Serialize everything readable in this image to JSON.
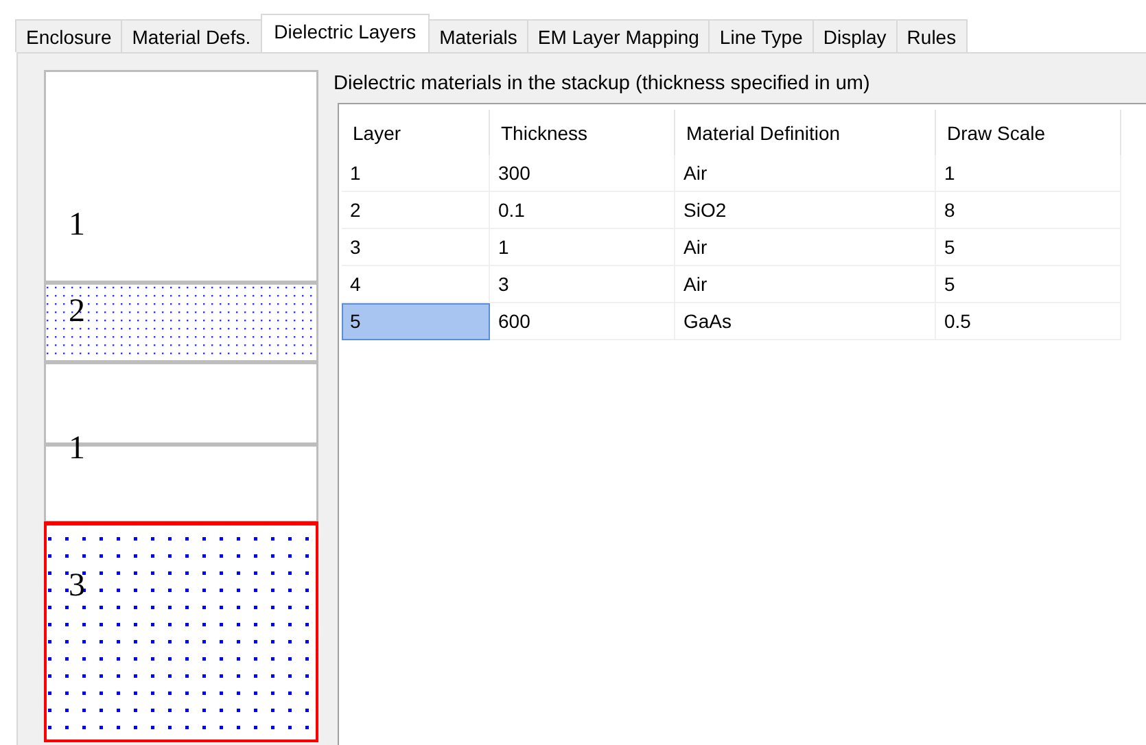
{
  "tabs": [
    {
      "label": "Enclosure",
      "selected": false
    },
    {
      "label": "Material Defs.",
      "selected": false
    },
    {
      "label": "Dielectric Layers",
      "selected": true
    },
    {
      "label": "Materials",
      "selected": false
    },
    {
      "label": "EM Layer Mapping",
      "selected": false
    },
    {
      "label": "Line Type",
      "selected": false
    },
    {
      "label": "Display",
      "selected": false
    },
    {
      "label": "Rules",
      "selected": false
    }
  ],
  "stackup_drawing": {
    "layers": [
      {
        "label": "1",
        "kind": "plain",
        "selected": false
      },
      {
        "label": "2",
        "kind": "fine-dots",
        "selected": false
      },
      {
        "kind": "plain",
        "selected": false
      },
      {
        "label": "1",
        "kind": "plain",
        "selected": false
      },
      {
        "label": "3",
        "kind": "coarse-dots",
        "selected": true
      }
    ]
  },
  "table": {
    "caption": "Dielectric materials in the stackup (thickness specified in um)",
    "columns": [
      "Layer",
      "Thickness",
      "Material Definition",
      "Draw Scale"
    ],
    "rows": [
      {
        "cells": [
          "1",
          "300",
          "Air",
          "1"
        ],
        "selected": false
      },
      {
        "cells": [
          "2",
          "0.1",
          "SiO2",
          "8"
        ],
        "selected": false
      },
      {
        "cells": [
          "3",
          "1",
          "Air",
          "5"
        ],
        "selected": false
      },
      {
        "cells": [
          "4",
          "3",
          "Air",
          "5"
        ],
        "selected": false
      },
      {
        "cells": [
          "5",
          "600",
          "GaAs",
          "0.5"
        ],
        "selected": true
      }
    ]
  }
}
